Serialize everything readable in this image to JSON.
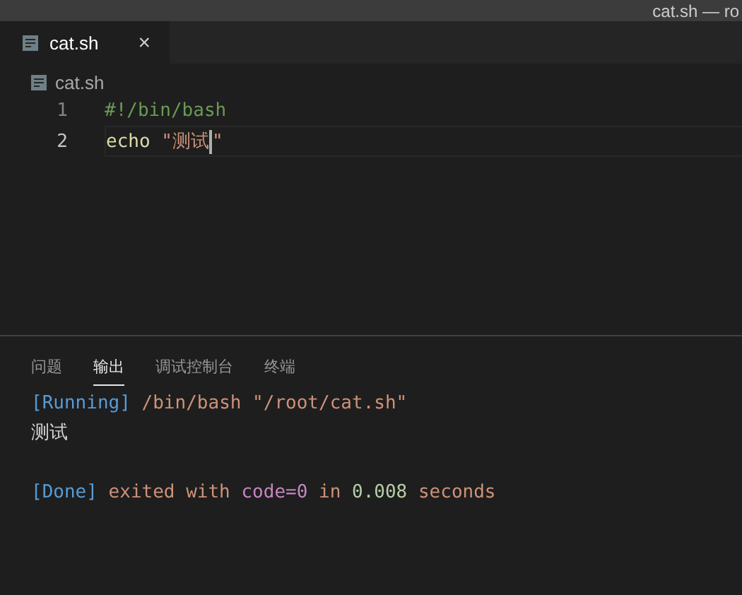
{
  "window": {
    "title": "cat.sh — ro"
  },
  "tabs": [
    {
      "label": "cat.sh",
      "selected": true,
      "close": "×"
    }
  ],
  "breadcrumb": {
    "label": "cat.sh"
  },
  "editor": {
    "lines": [
      {
        "number": "1",
        "current": false,
        "tokens": [
          {
            "kind": "comment",
            "text": "#!/bin/bash"
          }
        ]
      },
      {
        "number": "2",
        "current": true,
        "tokens": [
          {
            "kind": "builtin",
            "text": "echo"
          },
          {
            "kind": "string",
            "text": " \"测试"
          },
          {
            "kind": "cursor"
          },
          {
            "kind": "string",
            "text": "\""
          }
        ]
      }
    ]
  },
  "panel": {
    "tabs": [
      {
        "label": "问题",
        "selected": false
      },
      {
        "label": "输出",
        "selected": true
      },
      {
        "label": "调试控制台",
        "selected": false
      },
      {
        "label": "终端",
        "selected": false
      }
    ],
    "output": [
      {
        "lines": [
          [
            {
              "kind": "bracket",
              "text": "[Running]"
            },
            {
              "kind": "string",
              "text": " /bin/bash \"/root/cat.sh\""
            }
          ],
          [
            {
              "kind": "plain",
              "text": "测试"
            }
          ]
        ]
      },
      {
        "lines": [
          [
            {
              "kind": "bracket",
              "text": "[Done]"
            },
            {
              "kind": "string",
              "text": " exited with "
            },
            {
              "kind": "keyword",
              "text": "code=0"
            },
            {
              "kind": "string",
              "text": " in "
            },
            {
              "kind": "number",
              "text": "0.008"
            },
            {
              "kind": "string",
              "text": " seconds"
            }
          ]
        ]
      }
    ]
  }
}
